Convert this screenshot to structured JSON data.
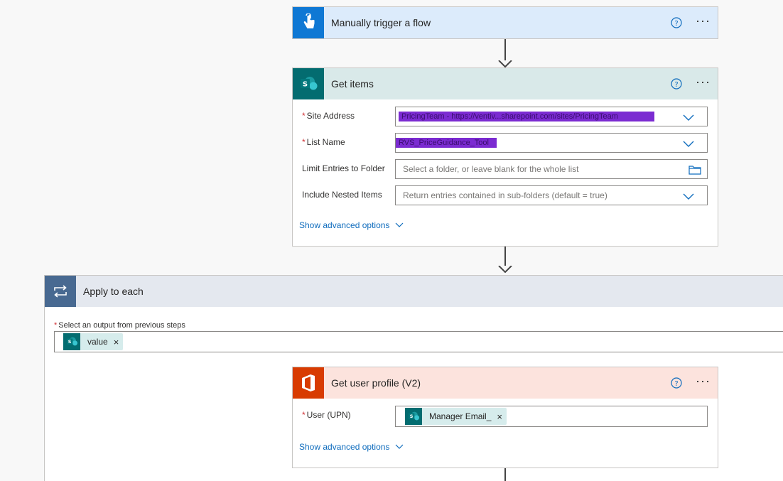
{
  "trigger": {
    "title": "Manually trigger a flow"
  },
  "get_items": {
    "title": "Get items",
    "site_address": {
      "label": "Site Address",
      "value": "PricingTeam - https://ventiv...sharepoint.com/sites/PricingTeam"
    },
    "list_name": {
      "label": "List Name",
      "value": "RVS_PriceGuidance_Tool"
    },
    "limit_folder": {
      "label": "Limit Entries to Folder",
      "placeholder": "Select a folder, or leave blank for the whole list"
    },
    "nested_items": {
      "label": "Include Nested Items",
      "placeholder": "Return entries contained in sub-folders (default = true)"
    },
    "show_advanced": "Show advanced options"
  },
  "apply_each": {
    "title": "Apply to each",
    "select_label": "Select an output from previous steps",
    "token": "value"
  },
  "user_profile": {
    "title": "Get user profile (V2)",
    "user_label": "User (UPN)",
    "token": "Manager Email_",
    "show_advanced": "Show advanced options"
  },
  "colors": {
    "trigger_header": "#dcebfb",
    "trigger_icon": "#0f78d4",
    "sharepoint_header": "#d9e9e9",
    "sharepoint_icon": "#036c70",
    "apply_header": "#e4e8ef",
    "apply_icon": "#486991",
    "office_header": "#fce3dd",
    "office_icon": "#d83b01",
    "link": "#0f6cbd",
    "redact": "#7b2bd1"
  },
  "icons": [
    "touch-icon",
    "sharepoint-icon",
    "loop-icon",
    "office-icon",
    "help-icon",
    "more-icon",
    "chevron-down-icon",
    "folder-icon",
    "close-icon"
  ]
}
